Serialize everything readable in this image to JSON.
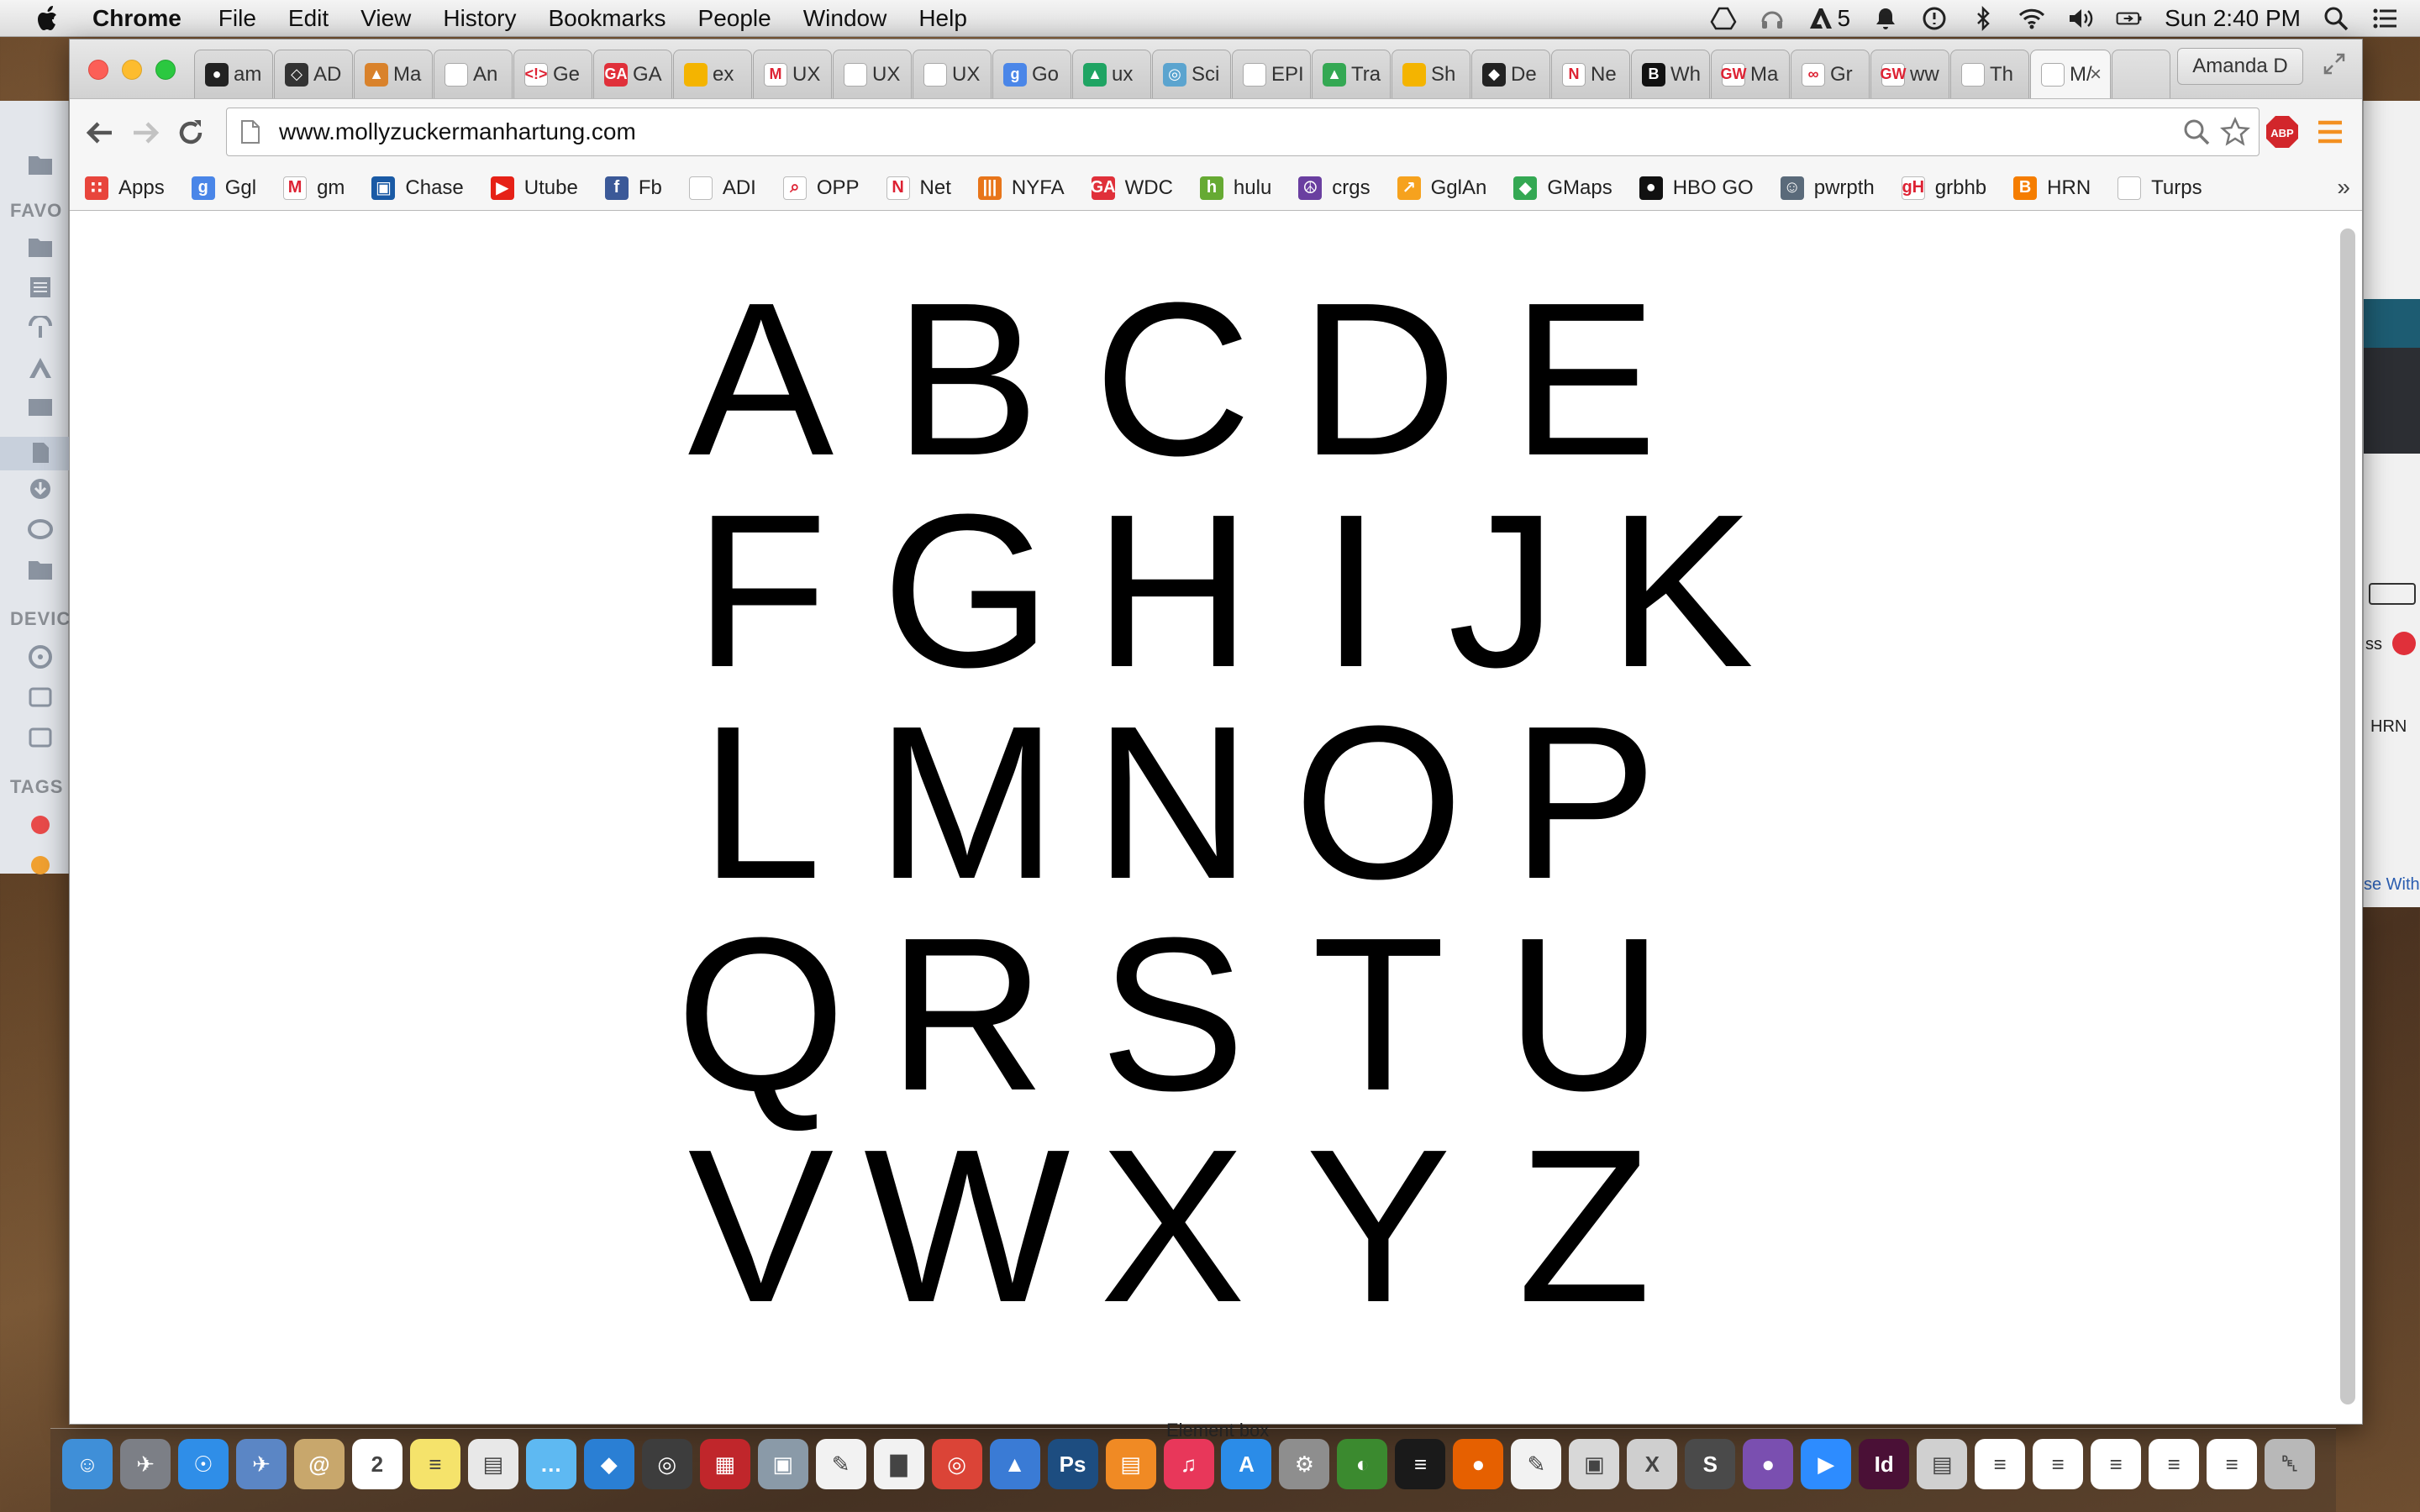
{
  "menubar": {
    "app_name": "Chrome",
    "items": [
      "File",
      "Edit",
      "View",
      "History",
      "Bookmarks",
      "People",
      "Window",
      "Help"
    ],
    "adobe_count": "5",
    "clock": "Sun 2:40 PM"
  },
  "finder": {
    "favorites_label": "FAVO",
    "devices_label": "DEVIC",
    "tags_label": "TAGS"
  },
  "right_window": {
    "ss_label": "ss",
    "hrn_label": "HRN",
    "with_label": "se With"
  },
  "tabs": [
    {
      "label": "am",
      "icon": "github-icon",
      "color": "#222222",
      "glyph": "●"
    },
    {
      "label": "AD",
      "icon": "codepen-icon",
      "color": "#333333",
      "glyph": "◇"
    },
    {
      "label": "Ma",
      "icon": "fox-icon",
      "color": "#d9822b",
      "glyph": "▲"
    },
    {
      "label": "An",
      "icon": "page-icon",
      "color": "#ffffff",
      "glyph": ""
    },
    {
      "label": "Ge",
      "icon": "code-icon",
      "color": "#ffffff",
      "glyph": "<!>"
    },
    {
      "label": "GA",
      "icon": "ga-icon",
      "color": "#e0303a",
      "glyph": "GA"
    },
    {
      "label": "ex",
      "icon": "slides-icon",
      "color": "#f4b400",
      "glyph": ""
    },
    {
      "label": "UX",
      "icon": "gmail-icon",
      "color": "#ffffff",
      "glyph": "M"
    },
    {
      "label": "UX",
      "icon": "page-icon",
      "color": "#ffffff",
      "glyph": ""
    },
    {
      "label": "UX",
      "icon": "page-icon",
      "color": "#ffffff",
      "glyph": ""
    },
    {
      "label": "Go",
      "icon": "google-icon",
      "color": "#4a86e8",
      "glyph": "g"
    },
    {
      "label": "ux",
      "icon": "drive-icon",
      "color": "#1fa463",
      "glyph": "▲"
    },
    {
      "label": "Sci",
      "icon": "sci-icon",
      "color": "#5ba4cf",
      "glyph": "◎"
    },
    {
      "label": "EPI",
      "icon": "page-icon",
      "color": "#ffffff",
      "glyph": ""
    },
    {
      "label": "Tra",
      "icon": "maps-icon",
      "color": "#34a853",
      "glyph": "▲"
    },
    {
      "label": "Sh",
      "icon": "slides-icon",
      "color": "#f4b400",
      "glyph": ""
    },
    {
      "label": "De",
      "icon": "diamond-icon",
      "color": "#222222",
      "glyph": "◆"
    },
    {
      "label": "Ne",
      "icon": "netflix-icon",
      "color": "#ffffff",
      "glyph": "N"
    },
    {
      "label": "Wh",
      "icon": "hex-icon",
      "color": "#111111",
      "glyph": "B"
    },
    {
      "label": "Ma",
      "icon": "gw-icon",
      "color": "#ffffff",
      "glyph": "GW"
    },
    {
      "label": "Gr",
      "icon": "tripadvisor-icon",
      "color": "#ffffff",
      "glyph": "∞"
    },
    {
      "label": "ww",
      "icon": "gw-icon",
      "color": "#ffffff",
      "glyph": "GW"
    },
    {
      "label": "Th",
      "icon": "page-icon",
      "color": "#ffffff",
      "glyph": ""
    },
    {
      "label": "M/",
      "icon": "page-icon",
      "color": "#ffffff",
      "glyph": "",
      "active": true
    }
  ],
  "profile_name": "Amanda D",
  "omnibox": {
    "url": "www.mollyzuckermanhartung.com"
  },
  "bookmarks": [
    {
      "label": "Apps",
      "icon": "apps-grid-icon",
      "color": "#e8453c",
      "glyph": "∷"
    },
    {
      "label": "Ggl",
      "icon": "google-icon",
      "color": "#4a86e8",
      "glyph": "g"
    },
    {
      "label": "gm",
      "icon": "gmail-icon",
      "color": "#ffffff",
      "glyph": "M"
    },
    {
      "label": "Chase",
      "icon": "chase-icon",
      "color": "#1a5aa5",
      "glyph": "▣"
    },
    {
      "label": "Utube",
      "icon": "youtube-icon",
      "color": "#e62117",
      "glyph": "▶"
    },
    {
      "label": "Fb",
      "icon": "facebook-icon",
      "color": "#3b5998",
      "glyph": "f"
    },
    {
      "label": "ADI",
      "icon": "page-icon",
      "color": "#ffffff",
      "glyph": ""
    },
    {
      "label": "OPP",
      "icon": "search-icon",
      "color": "#ffffff",
      "glyph": "⌕"
    },
    {
      "label": "Net",
      "icon": "netflix-icon",
      "color": "#ffffff",
      "glyph": "N"
    },
    {
      "label": "NYFA",
      "icon": "nyfa-icon",
      "color": "#e8751a",
      "glyph": "|||"
    },
    {
      "label": "WDC",
      "icon": "ga-icon",
      "color": "#e0303a",
      "glyph": "GA"
    },
    {
      "label": "hulu",
      "icon": "hulu-icon",
      "color": "#66aa33",
      "glyph": "h"
    },
    {
      "label": "crgs",
      "icon": "peace-icon",
      "color": "#6a3fa0",
      "glyph": "☮"
    },
    {
      "label": "GglAn",
      "icon": "analytics-icon",
      "color": "#f6a21e",
      "glyph": "↗"
    },
    {
      "label": "GMaps",
      "icon": "maps-icon",
      "color": "#34a853",
      "glyph": "◆"
    },
    {
      "label": "HBO GO",
      "icon": "hbo-icon",
      "color": "#111111",
      "glyph": "●"
    },
    {
      "label": "pwrpth",
      "icon": "avatar-icon",
      "color": "#5a6a7a",
      "glyph": "☺"
    },
    {
      "label": "grbhb",
      "icon": "grubhub-icon",
      "color": "#ffffff",
      "glyph": "gH"
    },
    {
      "label": "HRN",
      "icon": "blogger-icon",
      "color": "#f57d00",
      "glyph": "B"
    },
    {
      "label": "Turps",
      "icon": "page-icon",
      "color": "#ffffff",
      "glyph": ""
    }
  ],
  "letters": {
    "row1": [
      "A",
      "B",
      "C",
      "D",
      "E"
    ],
    "row2": [
      "F",
      "G",
      "H",
      "I",
      "J",
      "K"
    ],
    "row3": [
      "L",
      "M",
      "N",
      "O",
      "P"
    ],
    "row4": [
      "Q",
      "R",
      "S",
      "T",
      "U"
    ],
    "row5": [
      "V",
      "W",
      "X",
      "Y",
      "Z"
    ]
  },
  "dock": {
    "tooltip": "Element box",
    "calendar_day": "2",
    "apps": [
      {
        "name": "finder-icon",
        "color": "#3f8fd8",
        "glyph": "☺"
      },
      {
        "name": "launchpad-icon",
        "color": "#7c7f86",
        "glyph": "✈"
      },
      {
        "name": "safari-icon",
        "color": "#2f8ee8",
        "glyph": "☉"
      },
      {
        "name": "mail-bird-icon",
        "color": "#5b86c5",
        "glyph": "✈"
      },
      {
        "name": "contacts-icon",
        "color": "#c8a76c",
        "glyph": "@"
      },
      {
        "name": "calendar-icon",
        "color": "#ffffff",
        "glyph": "2"
      },
      {
        "name": "notes-icon",
        "color": "#f5e36b",
        "glyph": "≡"
      },
      {
        "name": "preview-icon",
        "color": "#e8e8e8",
        "glyph": "▤"
      },
      {
        "name": "messages-icon",
        "color": "#5eb9f2",
        "glyph": "…"
      },
      {
        "name": "dropbox-icon",
        "color": "#2a7fd4",
        "glyph": "◆"
      },
      {
        "name": "facetime-icon",
        "color": "#3d3d3d",
        "glyph": "◎"
      },
      {
        "name": "photobooth-icon",
        "color": "#c0262b",
        "glyph": "▦"
      },
      {
        "name": "image-capture-icon",
        "color": "#8a9aa8",
        "glyph": "▣"
      },
      {
        "name": "textedit-icon",
        "color": "#f2f2f2",
        "glyph": "✎"
      },
      {
        "name": "numbers-icon",
        "color": "#f2f2f2",
        "glyph": "▇"
      },
      {
        "name": "chrome-icon",
        "color": "#db4437",
        "glyph": "◎"
      },
      {
        "name": "keynote-icon",
        "color": "#3a7bd5",
        "glyph": "▲"
      },
      {
        "name": "photoshop-icon",
        "color": "#1d4d80",
        "glyph": "Ps"
      },
      {
        "name": "ibooks-icon",
        "color": "#f08a24",
        "glyph": "▤"
      },
      {
        "name": "itunes-icon",
        "color": "#e8375a",
        "glyph": "♫"
      },
      {
        "name": "appstore-icon",
        "color": "#2b8ce8",
        "glyph": "A"
      },
      {
        "name": "system-prefs-icon",
        "color": "#8e8e8e",
        "glyph": "⚙"
      },
      {
        "name": "globe-icon",
        "color": "#3b8a2f",
        "glyph": "◐"
      },
      {
        "name": "spotify-icon",
        "color": "#1a1a1a",
        "glyph": "≡"
      },
      {
        "name": "firefox-icon",
        "color": "#e66000",
        "glyph": "●"
      },
      {
        "name": "pages-icon",
        "color": "#f2f2f2",
        "glyph": "✎"
      },
      {
        "name": "iphoto-icon",
        "color": "#d8d8d8",
        "glyph": "▣"
      },
      {
        "name": "xcode-icon",
        "color": "#cfcfcf",
        "glyph": "X"
      },
      {
        "name": "sublime-icon",
        "color": "#4a4a4a",
        "glyph": "S"
      },
      {
        "name": "github-icon",
        "color": "#7a4fb0",
        "glyph": "●"
      },
      {
        "name": "zoom-icon",
        "color": "#2d8cff",
        "glyph": "▶"
      },
      {
        "name": "indesign-icon",
        "color": "#4a1036",
        "glyph": "Id"
      },
      {
        "name": "downloads-stack-icon",
        "color": "#d0d0d0",
        "glyph": "▤"
      },
      {
        "name": "document-icon",
        "color": "#ffffff",
        "glyph": "≡"
      },
      {
        "name": "document-icon",
        "color": "#ffffff",
        "glyph": "≡"
      },
      {
        "name": "document-icon",
        "color": "#ffffff",
        "glyph": "≡"
      },
      {
        "name": "document-icon",
        "color": "#ffffff",
        "glyph": "≡"
      },
      {
        "name": "document-icon",
        "color": "#ffffff",
        "glyph": "≡"
      },
      {
        "name": "trash-icon",
        "color": "#b8b8b8",
        "glyph": "␡"
      }
    ]
  }
}
